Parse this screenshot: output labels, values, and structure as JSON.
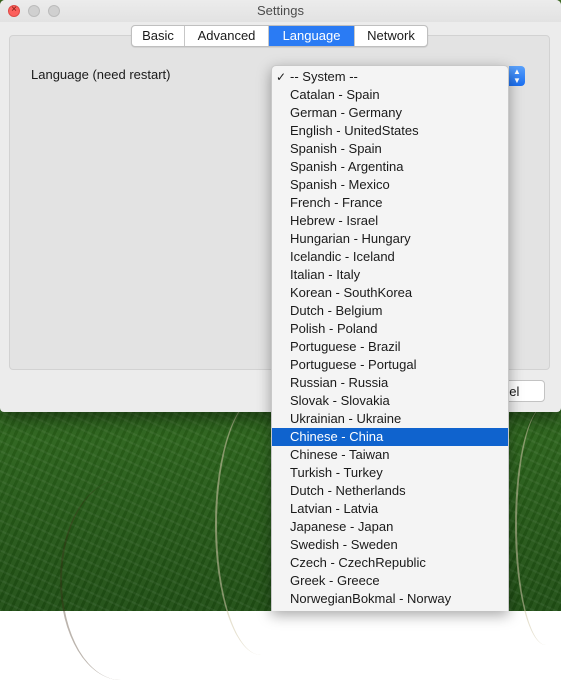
{
  "window": {
    "title": "Settings"
  },
  "tabs": [
    {
      "label": "Basic"
    },
    {
      "label": "Advanced"
    },
    {
      "label": "Language"
    },
    {
      "label": "Network"
    }
  ],
  "active_tab": "Language",
  "language_setting": {
    "label": "Language (need restart)",
    "checked_option": "-- System --",
    "highlighted_option": "Chinese - China",
    "options": [
      "-- System --",
      "Catalan - Spain",
      "German - Germany",
      "English - UnitedStates",
      "Spanish - Spain",
      "Spanish - Argentina",
      "Spanish - Mexico",
      "French - France",
      "Hebrew - Israel",
      "Hungarian - Hungary",
      "Icelandic - Iceland",
      "Italian - Italy",
      "Korean - SouthKorea",
      "Dutch - Belgium",
      "Polish - Poland",
      "Portuguese - Brazil",
      "Portuguese - Portugal",
      "Russian - Russia",
      "Slovak - Slovakia",
      "Ukrainian - Ukraine",
      "Chinese - China",
      "Chinese - Taiwan",
      "Turkish - Turkey",
      "Dutch - Netherlands",
      "Latvian - Latvia",
      "Japanese - Japan",
      "Swedish - Sweden",
      "Czech - CzechRepublic",
      "Greek - Greece",
      "NorwegianBokmal - Norway"
    ]
  },
  "footer": {
    "cancel_visible_text": "ncel"
  },
  "colors": {
    "accent": "#2a7bf4",
    "highlight": "#0f63ce",
    "close_button": "#fc605c"
  },
  "icons": {
    "close": "close-icon",
    "minimize": "minimize-icon",
    "zoom": "zoom-icon",
    "checkmark": "checkmark-icon",
    "select_arrows": "chevron-updown-icon"
  }
}
